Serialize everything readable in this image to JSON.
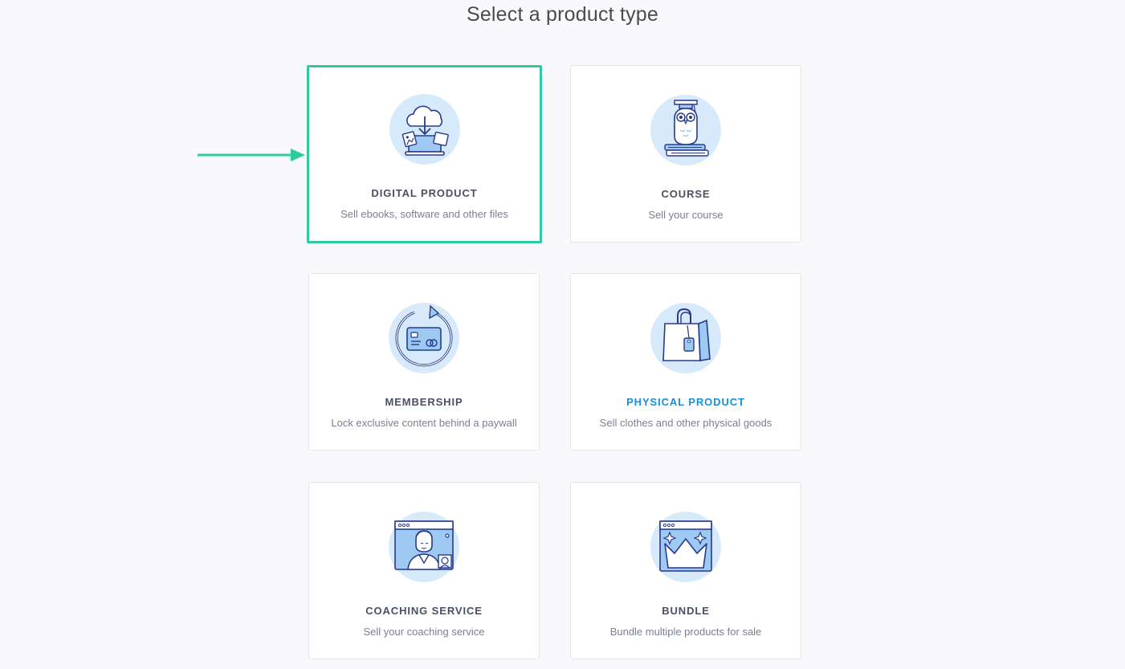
{
  "page": {
    "title": "Select a product type"
  },
  "colors": {
    "selected_border": "#2ecb9e",
    "accent_title": "#1a8ed8",
    "icon_bg": "#d6eafc",
    "icon_stroke": "#283a8c"
  },
  "cards": [
    {
      "title": "DIGITAL PRODUCT",
      "description": "Sell ebooks, software and other files",
      "icon": "cloud-download-laptop-icon",
      "selected": true
    },
    {
      "title": "COURSE",
      "description": "Sell your course",
      "icon": "owl-books-icon",
      "selected": false
    },
    {
      "title": "MEMBERSHIP",
      "description": "Lock exclusive content behind a paywall",
      "icon": "recurring-card-icon",
      "selected": false
    },
    {
      "title": "PHYSICAL PRODUCT",
      "description": "Sell clothes and other physical goods",
      "icon": "shopping-bag-icon",
      "selected": false
    },
    {
      "title": "COACHING SERVICE",
      "description": "Sell your coaching service",
      "icon": "video-call-icon",
      "selected": false
    },
    {
      "title": "BUNDLE",
      "description": "Bundle multiple products for sale",
      "icon": "crown-window-icon",
      "selected": false
    }
  ]
}
